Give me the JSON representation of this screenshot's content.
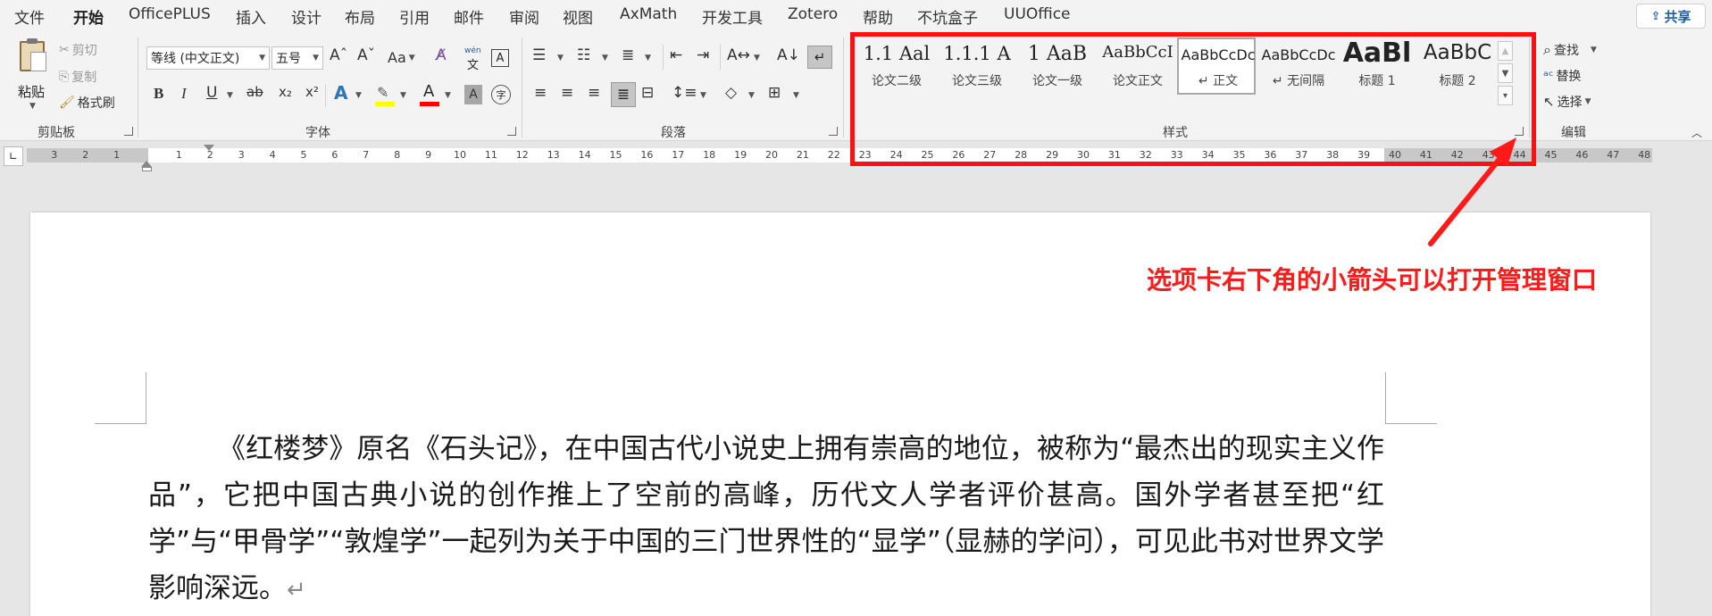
{
  "menubar": {
    "tabs": [
      "文件",
      "开始",
      "OfficePLUS",
      "插入",
      "设计",
      "布局",
      "引用",
      "邮件",
      "审阅",
      "视图",
      "AxMath",
      "开发工具",
      "Zotero",
      "帮助",
      "不坑盒子",
      "UUOffice"
    ],
    "active_tab": "开始",
    "share_label": "共享"
  },
  "clipboard": {
    "paste_label": "粘贴",
    "cut_label": "剪切",
    "copy_label": "复制",
    "format_painter_label": "格式刷",
    "group_label": "剪贴板"
  },
  "font": {
    "font_name": "等线 (中文正文)",
    "font_size": "五号",
    "grow_label": "Aˆ",
    "shrink_label": "Aˇ",
    "case_label": "Aa",
    "phonetic_top": "wén",
    "phonetic_bottom": "文",
    "bold": "B",
    "italic": "I",
    "underline": "U",
    "strike": "ab",
    "subscript": "x₂",
    "superscript": "x²",
    "enclose_char": "字",
    "group_label": "字体"
  },
  "paragraph": {
    "group_label": "段落"
  },
  "styles": {
    "items": [
      {
        "preview": "1.1 Aal",
        "name": "论文二级"
      },
      {
        "preview": "1.1.1 A",
        "name": "论文三级"
      },
      {
        "preview": "1 AaB",
        "name": "论文一级"
      },
      {
        "preview": "AaBbCcI",
        "name": "论文正文"
      },
      {
        "preview": "AaBbCcDc",
        "name": "↵ 正文"
      },
      {
        "preview": "AaBbCcDc",
        "name": "↵ 无间隔"
      },
      {
        "preview": "AaBl",
        "name": "标题 1"
      },
      {
        "preview": "AaBbC",
        "name": "标题 2"
      }
    ],
    "selected": "↵ 正文",
    "group_label": "样式"
  },
  "editing": {
    "find_label": "查找",
    "replace_label": "替换",
    "select_label": "选择",
    "group_label": "编辑"
  },
  "ruler": {
    "left_numbers": [
      "3",
      "2",
      "1"
    ],
    "numbers": [
      "1",
      "2",
      "3",
      "4",
      "5",
      "6",
      "7",
      "8",
      "9",
      "10",
      "11",
      "12",
      "13",
      "14",
      "15",
      "16",
      "17",
      "18",
      "19",
      "20",
      "21",
      "22",
      "23",
      "24",
      "25",
      "26",
      "27",
      "28",
      "29",
      "30",
      "31",
      "32",
      "33",
      "34",
      "35",
      "36",
      "37",
      "38",
      "39",
      "40",
      "41",
      "42",
      "43",
      "44",
      "45",
      "46",
      "47",
      "48"
    ]
  },
  "document": {
    "paragraph": "《红楼梦》原名《石头记》，在中国古代小说史上拥有崇高的地位，被称为“最杰出的现实主义作品”，它把中国古典小说的创作推上了空前的高峰，历代文人学者评价甚高。国外学者甚至把“红学”与“甲骨学”“敦煌学”一起列为关于中国的三门世界性的“显学”（显赫的学问），可见此书对世界文学影响深远。",
    "paragraph_mark": "↵"
  },
  "annotation": {
    "text": "选项卡右下角的小箭头可以打开管理窗口",
    "color": "#ff1a1a"
  },
  "colors": {
    "accent": "#2b579a",
    "highlight": "#ffff00",
    "font_color": "#ff0000"
  }
}
